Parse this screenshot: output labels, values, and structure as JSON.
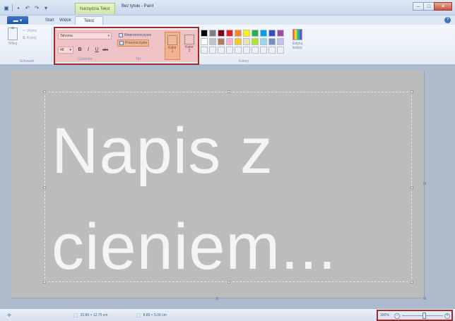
{
  "window": {
    "title": "Bez tytułu - Paint",
    "context_tab": "Narzędzia Tekst"
  },
  "qat": {
    "icons": [
      "paint-app-icon",
      "save-icon",
      "undo-icon",
      "redo-icon",
      "customize-qat-icon"
    ]
  },
  "tabs": {
    "file_label": "",
    "items": [
      {
        "label": "Start"
      },
      {
        "label": "Widok"
      },
      {
        "label": "Tekst"
      }
    ]
  },
  "ribbon": {
    "clipboard": {
      "group_label": "Schowek",
      "paste_label": "Wklej",
      "cut_label": "Wytnij",
      "copy_label": "Kopiuj"
    },
    "font": {
      "group_label": "Czcionka",
      "name": "Tahoma",
      "size": "48",
      "bold": "B",
      "italic": "I",
      "underline": "U",
      "strike": "abc"
    },
    "background": {
      "group_label": "Tło",
      "opaque_label": "Nieprzezroczyste",
      "transparent_label": "Przezroczyste"
    },
    "colors": {
      "group_label": "Kolory",
      "color1_label": "Kolor\n1",
      "color2_label": "Kolor\n2",
      "color1_hex": "#f4b896",
      "color2_hex": "#f2c4c4",
      "edit_label": "Edytuj\nkolory",
      "palette": [
        "#000000",
        "#7f7f7f",
        "#880015",
        "#ed1c24",
        "#ff7f27",
        "#fff200",
        "#22b14c",
        "#00a2e8",
        "#3f48cc",
        "#a349a4",
        "#ffffff",
        "#c3c3c3",
        "#b97a57",
        "#ffaec9",
        "#ffc90e",
        "#efe4b0",
        "#b5e61d",
        "#99d9ea",
        "#7092be",
        "#c8bfe7",
        "#f0f0f0",
        "#f0f0f0",
        "#f0f0f0",
        "#f0f0f0",
        "#f0f0f0",
        "#f0f0f0",
        "#f0f0f0",
        "#f0f0f0",
        "#f0f0f0",
        "#f0f0f0"
      ]
    }
  },
  "canvas": {
    "text": "Napis z\ncieniem...",
    "background": "#bcbcbc",
    "text_color": "#f4f4f4"
  },
  "status": {
    "cursor_pos": "",
    "selection_size": "23,89 × 12,75 cm",
    "image_size": "8,89 × 5,00 cm",
    "zoom": "300%",
    "zoom_minus": "−",
    "zoom_plus": "+"
  },
  "colors": {
    "highlight_border": "#a02a2a",
    "selected_option": "#f3b58f",
    "panel_bg": "#efc3c6"
  }
}
